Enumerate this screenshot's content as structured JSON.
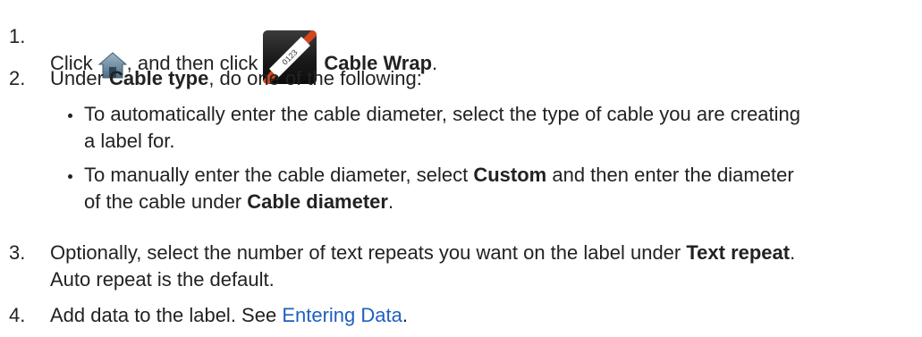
{
  "steps": [
    {
      "num": "1.",
      "prefix": "Click",
      "middle": ", and then click",
      "bold": "Cable Wrap",
      "suffix": "."
    },
    {
      "num": "2.",
      "prefix": "Under ",
      "bold": "Cable type",
      "suffix": ", do one of the following:"
    },
    {
      "num": "3.",
      "line1_prefix": "Optionally, select the number of text repeats you want on the label under ",
      "line1_bold": "Text repeat",
      "line1_suffix": ".",
      "line2": "Auto repeat is the default."
    },
    {
      "num": "4.",
      "prefix": "Add data to the label. See ",
      "link": "Entering Data",
      "suffix": "."
    }
  ],
  "bullets": [
    {
      "line1": "To automatically enter the cable diameter, select the type of cable you are creating",
      "line2": "a label for."
    },
    {
      "line1_prefix": "To manually enter the cable diameter, select ",
      "line1_bold": "Custom",
      "line1_suffix": " and then enter the diameter",
      "line2_prefix": "of the cable under ",
      "line2_bold": "Cable diameter",
      "line2_suffix": "."
    }
  ],
  "icons": {
    "home": "home-icon",
    "cable_wrap": "cable-wrap-icon",
    "cable_wrap_text": "0123"
  },
  "colors": {
    "link": "#1f5fbf",
    "text": "#222222"
  }
}
